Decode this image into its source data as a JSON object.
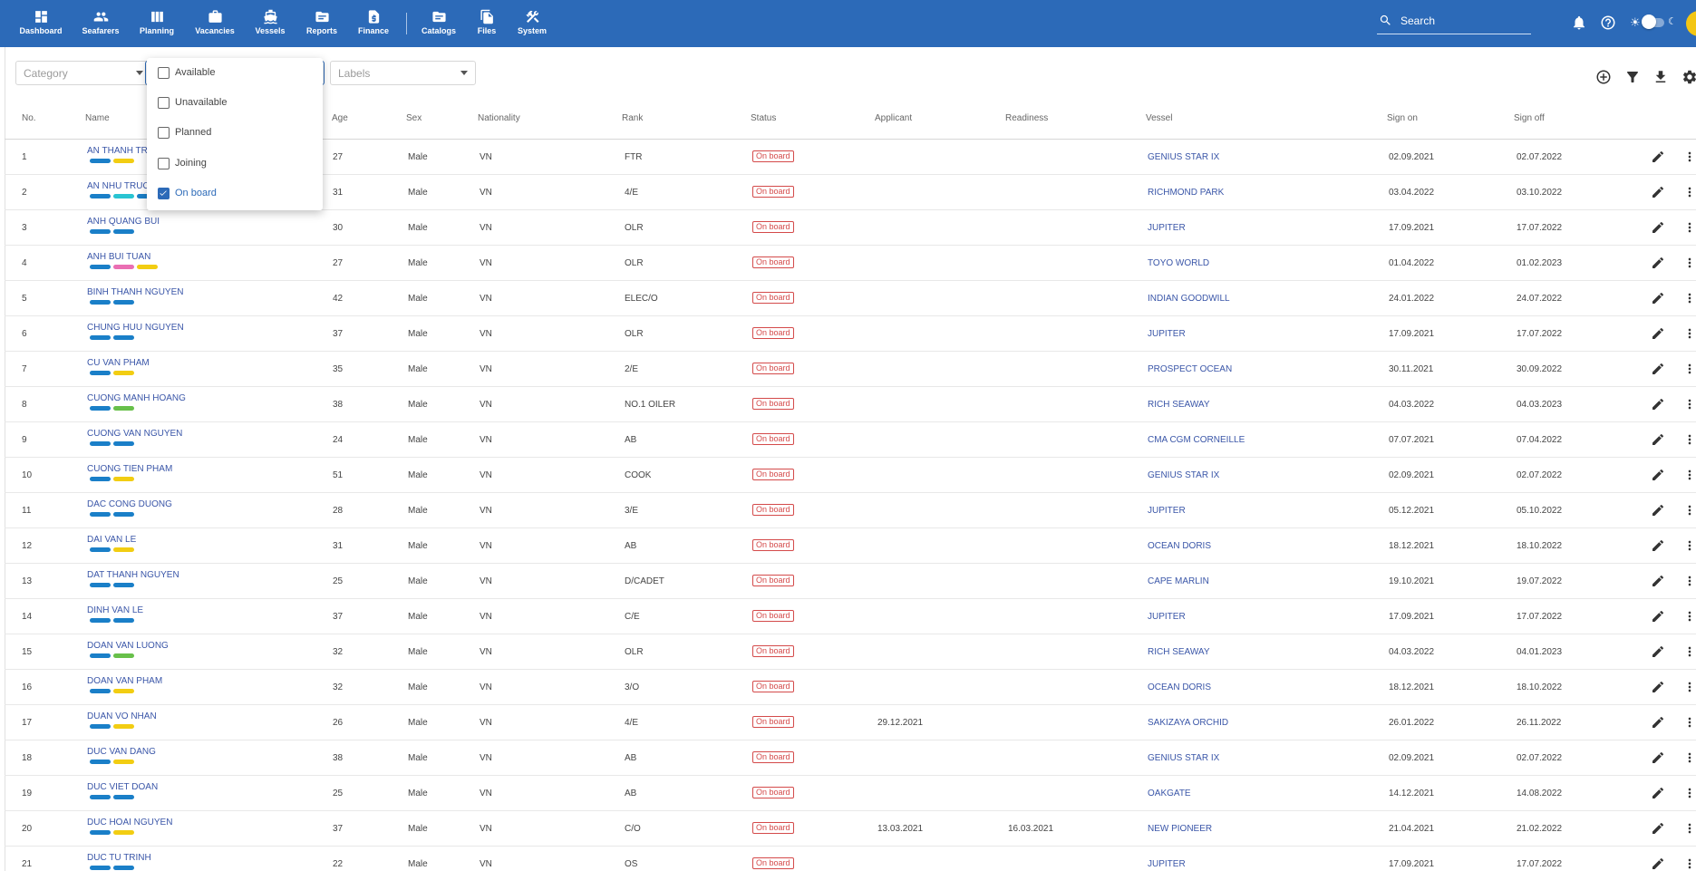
{
  "nav": {
    "items": [
      {
        "label": "Dashboard",
        "icon": "dashboard-icon"
      },
      {
        "label": "Seafarers",
        "icon": "people-icon"
      },
      {
        "label": "Planning",
        "icon": "columns-icon"
      },
      {
        "label": "Vacancies",
        "icon": "briefcase-icon"
      },
      {
        "label": "Vessels",
        "icon": "ship-icon"
      },
      {
        "label": "Reports",
        "icon": "folder-icon"
      },
      {
        "label": "Finance",
        "icon": "invoice-icon"
      },
      {
        "label": "Catalogs",
        "icon": "folder-icon"
      },
      {
        "label": "Files",
        "icon": "files-icon"
      },
      {
        "label": "System",
        "icon": "tools-icon"
      }
    ],
    "search_placeholder": "Search"
  },
  "filters": {
    "category_placeholder": "Category",
    "labels_placeholder": "Labels",
    "status_options": [
      {
        "label": "Available",
        "checked": false
      },
      {
        "label": "Unavailable",
        "checked": false
      },
      {
        "label": "Planned",
        "checked": false
      },
      {
        "label": "Joining",
        "checked": false
      },
      {
        "label": "On board",
        "checked": true
      }
    ]
  },
  "table": {
    "headers": [
      "No.",
      "Name",
      "Age",
      "Sex",
      "Nationality",
      "Rank",
      "Status",
      "Applicant",
      "Readiness",
      "Vessel",
      "Sign on",
      "Sign off"
    ],
    "label_colors": {
      "blue": "#1a7fc8",
      "yellow": "#f2cd12",
      "cyan": "#29c4d2",
      "pink": "#ea6fb3",
      "green": "#68c04a"
    },
    "rows": [
      {
        "no": "1",
        "name": "AN THANH TRUNG",
        "labels": [
          "blue",
          "yellow"
        ],
        "age": "27",
        "sex": "Male",
        "nat": "VN",
        "rank": "FTR",
        "status": "On board",
        "applicant": "",
        "readiness": "",
        "vessel": "GENIUS STAR IX",
        "sign_on": "02.09.2021",
        "sign_off": "02.07.2022"
      },
      {
        "no": "2",
        "name": "AN NHU TRUONG",
        "labels": [
          "blue",
          "cyan",
          "blue"
        ],
        "age": "31",
        "sex": "Male",
        "nat": "VN",
        "rank": "4/E",
        "status": "On board",
        "applicant": "",
        "readiness": "",
        "vessel": "RICHMOND PARK",
        "sign_on": "03.04.2022",
        "sign_off": "03.10.2022"
      },
      {
        "no": "3",
        "name": "ANH QUANG BUI",
        "labels": [
          "blue",
          "blue"
        ],
        "age": "30",
        "sex": "Male",
        "nat": "VN",
        "rank": "OLR",
        "status": "On board",
        "applicant": "",
        "readiness": "",
        "vessel": "JUPITER",
        "sign_on": "17.09.2021",
        "sign_off": "17.07.2022"
      },
      {
        "no": "4",
        "name": "ANH BUI TUAN",
        "labels": [
          "blue",
          "pink",
          "yellow"
        ],
        "age": "27",
        "sex": "Male",
        "nat": "VN",
        "rank": "OLR",
        "status": "On board",
        "applicant": "",
        "readiness": "",
        "vessel": "TOYO WORLD",
        "sign_on": "01.04.2022",
        "sign_off": "01.02.2023"
      },
      {
        "no": "5",
        "name": "BINH THANH NGUYEN",
        "labels": [
          "blue",
          "blue"
        ],
        "age": "42",
        "sex": "Male",
        "nat": "VN",
        "rank": "ELEC/O",
        "status": "On board",
        "applicant": "",
        "readiness": "",
        "vessel": "INDIAN GOODWILL",
        "sign_on": "24.01.2022",
        "sign_off": "24.07.2022"
      },
      {
        "no": "6",
        "name": "CHUNG HUU NGUYEN",
        "labels": [
          "blue",
          "blue"
        ],
        "age": "37",
        "sex": "Male",
        "nat": "VN",
        "rank": "OLR",
        "status": "On board",
        "applicant": "",
        "readiness": "",
        "vessel": "JUPITER",
        "sign_on": "17.09.2021",
        "sign_off": "17.07.2022"
      },
      {
        "no": "7",
        "name": "CU VAN PHAM",
        "labels": [
          "blue",
          "yellow"
        ],
        "age": "35",
        "sex": "Male",
        "nat": "VN",
        "rank": "2/E",
        "status": "On board",
        "applicant": "",
        "readiness": "",
        "vessel": "PROSPECT OCEAN",
        "sign_on": "30.11.2021",
        "sign_off": "30.09.2022"
      },
      {
        "no": "8",
        "name": "CUONG MANH HOANG",
        "labels": [
          "blue",
          "green"
        ],
        "age": "38",
        "sex": "Male",
        "nat": "VN",
        "rank": "NO.1 OILER",
        "status": "On board",
        "applicant": "",
        "readiness": "",
        "vessel": "RICH SEAWAY",
        "sign_on": "04.03.2022",
        "sign_off": "04.03.2023"
      },
      {
        "no": "9",
        "name": "CUONG VAN NGUYEN",
        "labels": [
          "blue",
          "blue"
        ],
        "age": "24",
        "sex": "Male",
        "nat": "VN",
        "rank": "AB",
        "status": "On board",
        "applicant": "",
        "readiness": "",
        "vessel": "CMA CGM CORNEILLE",
        "sign_on": "07.07.2021",
        "sign_off": "07.04.2022"
      },
      {
        "no": "10",
        "name": "CUONG TIEN PHAM",
        "labels": [
          "blue",
          "yellow"
        ],
        "age": "51",
        "sex": "Male",
        "nat": "VN",
        "rank": "COOK",
        "status": "On board",
        "applicant": "",
        "readiness": "",
        "vessel": "GENIUS STAR IX",
        "sign_on": "02.09.2021",
        "sign_off": "02.07.2022"
      },
      {
        "no": "11",
        "name": "DAC CONG DUONG",
        "labels": [
          "blue",
          "blue"
        ],
        "age": "28",
        "sex": "Male",
        "nat": "VN",
        "rank": "3/E",
        "status": "On board",
        "applicant": "",
        "readiness": "",
        "vessel": "JUPITER",
        "sign_on": "05.12.2021",
        "sign_off": "05.10.2022"
      },
      {
        "no": "12",
        "name": "DAI VAN LE",
        "labels": [
          "blue",
          "yellow"
        ],
        "age": "31",
        "sex": "Male",
        "nat": "VN",
        "rank": "AB",
        "status": "On board",
        "applicant": "",
        "readiness": "",
        "vessel": "OCEAN DORIS",
        "sign_on": "18.12.2021",
        "sign_off": "18.10.2022"
      },
      {
        "no": "13",
        "name": "DAT THANH NGUYEN",
        "labels": [
          "blue",
          "blue"
        ],
        "age": "25",
        "sex": "Male",
        "nat": "VN",
        "rank": "D/CADET",
        "status": "On board",
        "applicant": "",
        "readiness": "",
        "vessel": "CAPE MARLIN",
        "sign_on": "19.10.2021",
        "sign_off": "19.07.2022"
      },
      {
        "no": "14",
        "name": "DINH VAN LE",
        "labels": [
          "blue",
          "blue"
        ],
        "age": "37",
        "sex": "Male",
        "nat": "VN",
        "rank": "C/E",
        "status": "On board",
        "applicant": "",
        "readiness": "",
        "vessel": "JUPITER",
        "sign_on": "17.09.2021",
        "sign_off": "17.07.2022"
      },
      {
        "no": "15",
        "name": "DOAN VAN LUONG",
        "labels": [
          "blue",
          "green"
        ],
        "age": "32",
        "sex": "Male",
        "nat": "VN",
        "rank": "OLR",
        "status": "On board",
        "applicant": "",
        "readiness": "",
        "vessel": "RICH SEAWAY",
        "sign_on": "04.03.2022",
        "sign_off": "04.01.2023"
      },
      {
        "no": "16",
        "name": "DOAN VAN PHAM",
        "labels": [
          "blue",
          "yellow"
        ],
        "age": "32",
        "sex": "Male",
        "nat": "VN",
        "rank": "3/O",
        "status": "On board",
        "applicant": "",
        "readiness": "",
        "vessel": "OCEAN DORIS",
        "sign_on": "18.12.2021",
        "sign_off": "18.10.2022"
      },
      {
        "no": "17",
        "name": "DUAN VO NHAN",
        "labels": [
          "blue",
          "yellow"
        ],
        "age": "26",
        "sex": "Male",
        "nat": "VN",
        "rank": "4/E",
        "status": "On board",
        "applicant": "29.12.2021",
        "readiness": "",
        "vessel": "SAKIZAYA ORCHID",
        "sign_on": "26.01.2022",
        "sign_off": "26.11.2022"
      },
      {
        "no": "18",
        "name": "DUC VAN DANG",
        "labels": [
          "blue",
          "yellow"
        ],
        "age": "38",
        "sex": "Male",
        "nat": "VN",
        "rank": "AB",
        "status": "On board",
        "applicant": "",
        "readiness": "",
        "vessel": "GENIUS STAR IX",
        "sign_on": "02.09.2021",
        "sign_off": "02.07.2022"
      },
      {
        "no": "19",
        "name": "DUC VIET DOAN",
        "labels": [
          "blue",
          "blue"
        ],
        "age": "25",
        "sex": "Male",
        "nat": "VN",
        "rank": "AB",
        "status": "On board",
        "applicant": "",
        "readiness": "",
        "vessel": "OAKGATE",
        "sign_on": "14.12.2021",
        "sign_off": "14.08.2022"
      },
      {
        "no": "20",
        "name": "DUC HOAI NGUYEN",
        "labels": [
          "blue",
          "yellow"
        ],
        "age": "37",
        "sex": "Male",
        "nat": "VN",
        "rank": "C/O",
        "status": "On board",
        "applicant": "13.03.2021",
        "readiness": "16.03.2021",
        "vessel": "NEW PIONEER",
        "sign_on": "21.04.2021",
        "sign_off": "21.02.2022"
      },
      {
        "no": "21",
        "name": "DUC TU TRINH",
        "labels": [
          "blue",
          "blue"
        ],
        "age": "22",
        "sex": "Male",
        "nat": "VN",
        "rank": "OS",
        "status": "On board",
        "applicant": "",
        "readiness": "",
        "vessel": "JUPITER",
        "sign_on": "17.09.2021",
        "sign_off": "17.07.2022"
      }
    ]
  }
}
